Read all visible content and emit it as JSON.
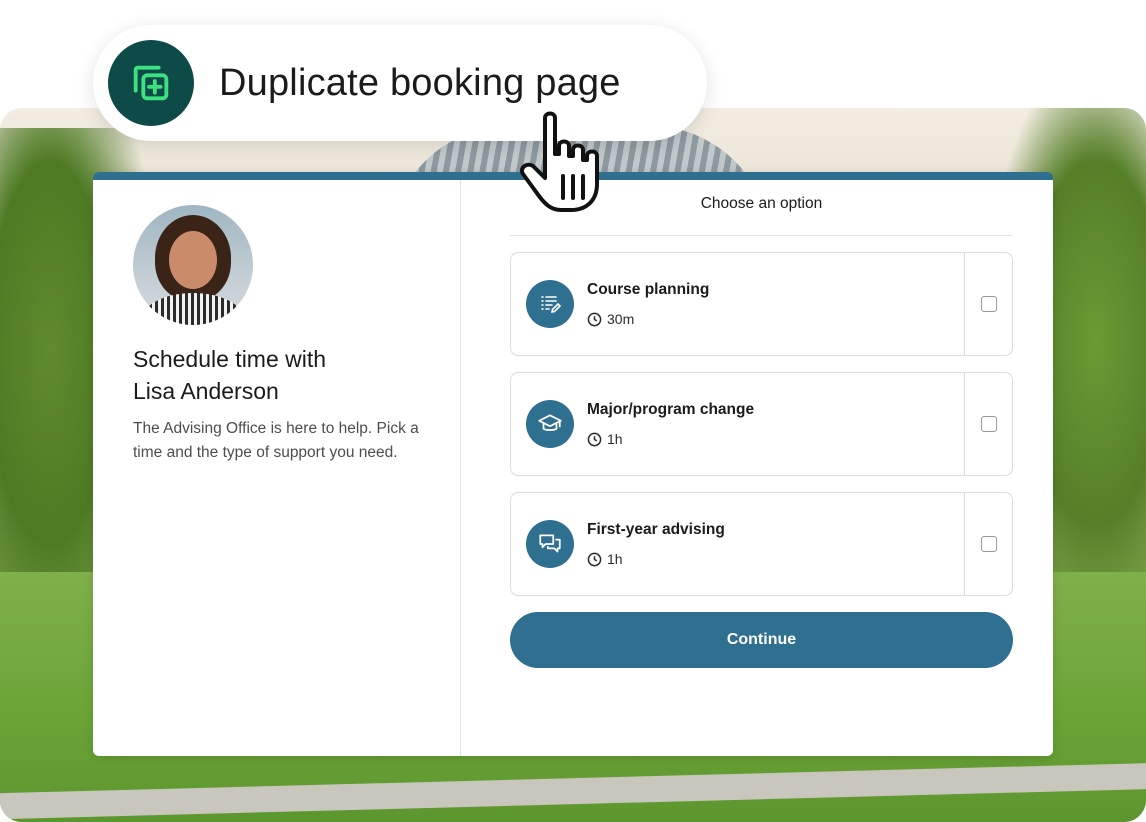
{
  "action": {
    "label": "Duplicate booking page",
    "icon": "duplicate-plus-icon"
  },
  "host": {
    "title_line1": "Schedule time with",
    "title_line2": "Lisa Anderson",
    "description": "The Advising Office is here to help. Pick a time and the type of support you need."
  },
  "picker": {
    "heading": "Choose an option",
    "options": [
      {
        "title": "Course planning",
        "duration": "30m",
        "icon": "checklist-edit-icon",
        "checked": false
      },
      {
        "title": "Major/program change",
        "duration": "1h",
        "icon": "graduation-cap-icon",
        "checked": false
      },
      {
        "title": "First-year advising",
        "duration": "1h",
        "icon": "chat-bubbles-icon",
        "checked": false
      }
    ],
    "continue_label": "Continue"
  },
  "colors": {
    "accent": "#2f6f8f",
    "pill_icon_bg": "#0d4a48",
    "pill_icon_fg": "#3ee07f"
  }
}
